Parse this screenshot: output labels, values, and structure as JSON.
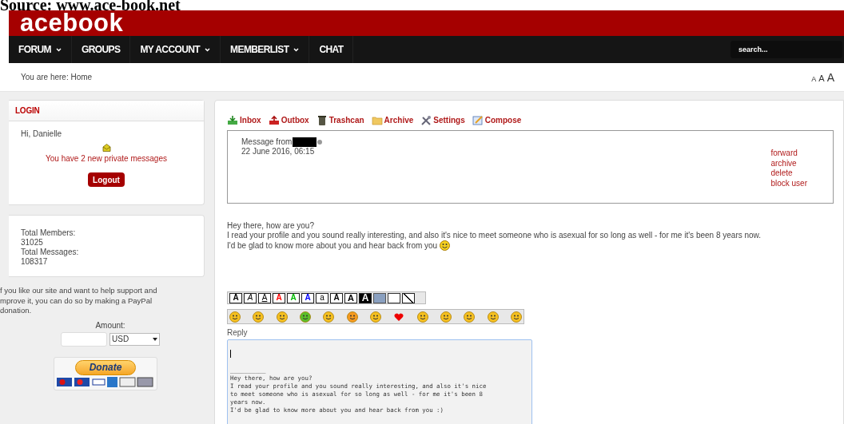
{
  "caption": "Source: www.ace-book.net",
  "logo": "acebook",
  "nav": [
    {
      "label": "FORUM",
      "has_menu": true
    },
    {
      "label": "GROUPS",
      "has_menu": false
    },
    {
      "label": "MY ACCOUNT",
      "has_menu": true
    },
    {
      "label": "MEMBERLIST",
      "has_menu": true
    },
    {
      "label": "CHAT",
      "has_menu": false
    }
  ],
  "search": {
    "placeholder": "search..."
  },
  "breadcrumb": "You are here: Home",
  "font_sizes": [
    "A",
    "A",
    "A"
  ],
  "login": {
    "title": "LOGIN",
    "greeting": "Hi, Danielle",
    "notice": "You have 2 new private messages",
    "logout": "Logout"
  },
  "stats": [
    "Total Members:",
    "31025",
    "Total Messages:",
    "108317"
  ],
  "donation": {
    "text": [
      "f you like our site and want to help support and",
      "mprove it, you can do so by making a PayPal",
      "donation."
    ],
    "amount_label": "Amount:",
    "currency": "USD",
    "button": "Donate"
  },
  "mail_tabs": [
    {
      "label": "Inbox",
      "kind": "inbox"
    },
    {
      "label": "Outbox",
      "kind": "outbox"
    },
    {
      "label": "Trashcan",
      "kind": "trash"
    },
    {
      "label": "Archive",
      "kind": "archive"
    },
    {
      "label": "Settings",
      "kind": "settings"
    },
    {
      "label": "Compose",
      "kind": "compose"
    }
  ],
  "message": {
    "from_label": "Message from",
    "date": "22 June 2016, 06:15",
    "actions": [
      "forward",
      "archive",
      "delete",
      "block user"
    ],
    "body": [
      "Hey there, how are you?",
      "I read your profile and you sound really interesting, and also it's nice to meet someone who is asexual for so long as well - for me it's been 8 years now.",
      "I'd be glad to know more about you and hear back from you"
    ]
  },
  "format_buttons": [
    {
      "kind": "bold",
      "label": "A"
    },
    {
      "kind": "italic",
      "label": "A"
    },
    {
      "kind": "underline",
      "label": "A"
    },
    {
      "kind": "color",
      "label": "A",
      "color": "#ff0000"
    },
    {
      "kind": "color",
      "label": "A",
      "color": "#00bb00"
    },
    {
      "kind": "color",
      "label": "A",
      "color": "#0000ff"
    },
    {
      "kind": "small",
      "label": "a"
    },
    {
      "kind": "medium",
      "label": "A"
    },
    {
      "kind": "large",
      "label": "A"
    },
    {
      "kind": "huge",
      "label": "A"
    },
    {
      "kind": "image"
    },
    {
      "kind": "link"
    },
    {
      "kind": "line"
    }
  ],
  "reply": {
    "label": "Reply",
    "quote": [
      "__________",
      "Hey there, how are you?",
      "I read your profile and you sound really interesting, and also it's nice",
      "to meet someone who is asexual for so long as well - for me it's been 8",
      "years now.",
      "I'd be glad to know more about you and hear back from you :)"
    ]
  }
}
